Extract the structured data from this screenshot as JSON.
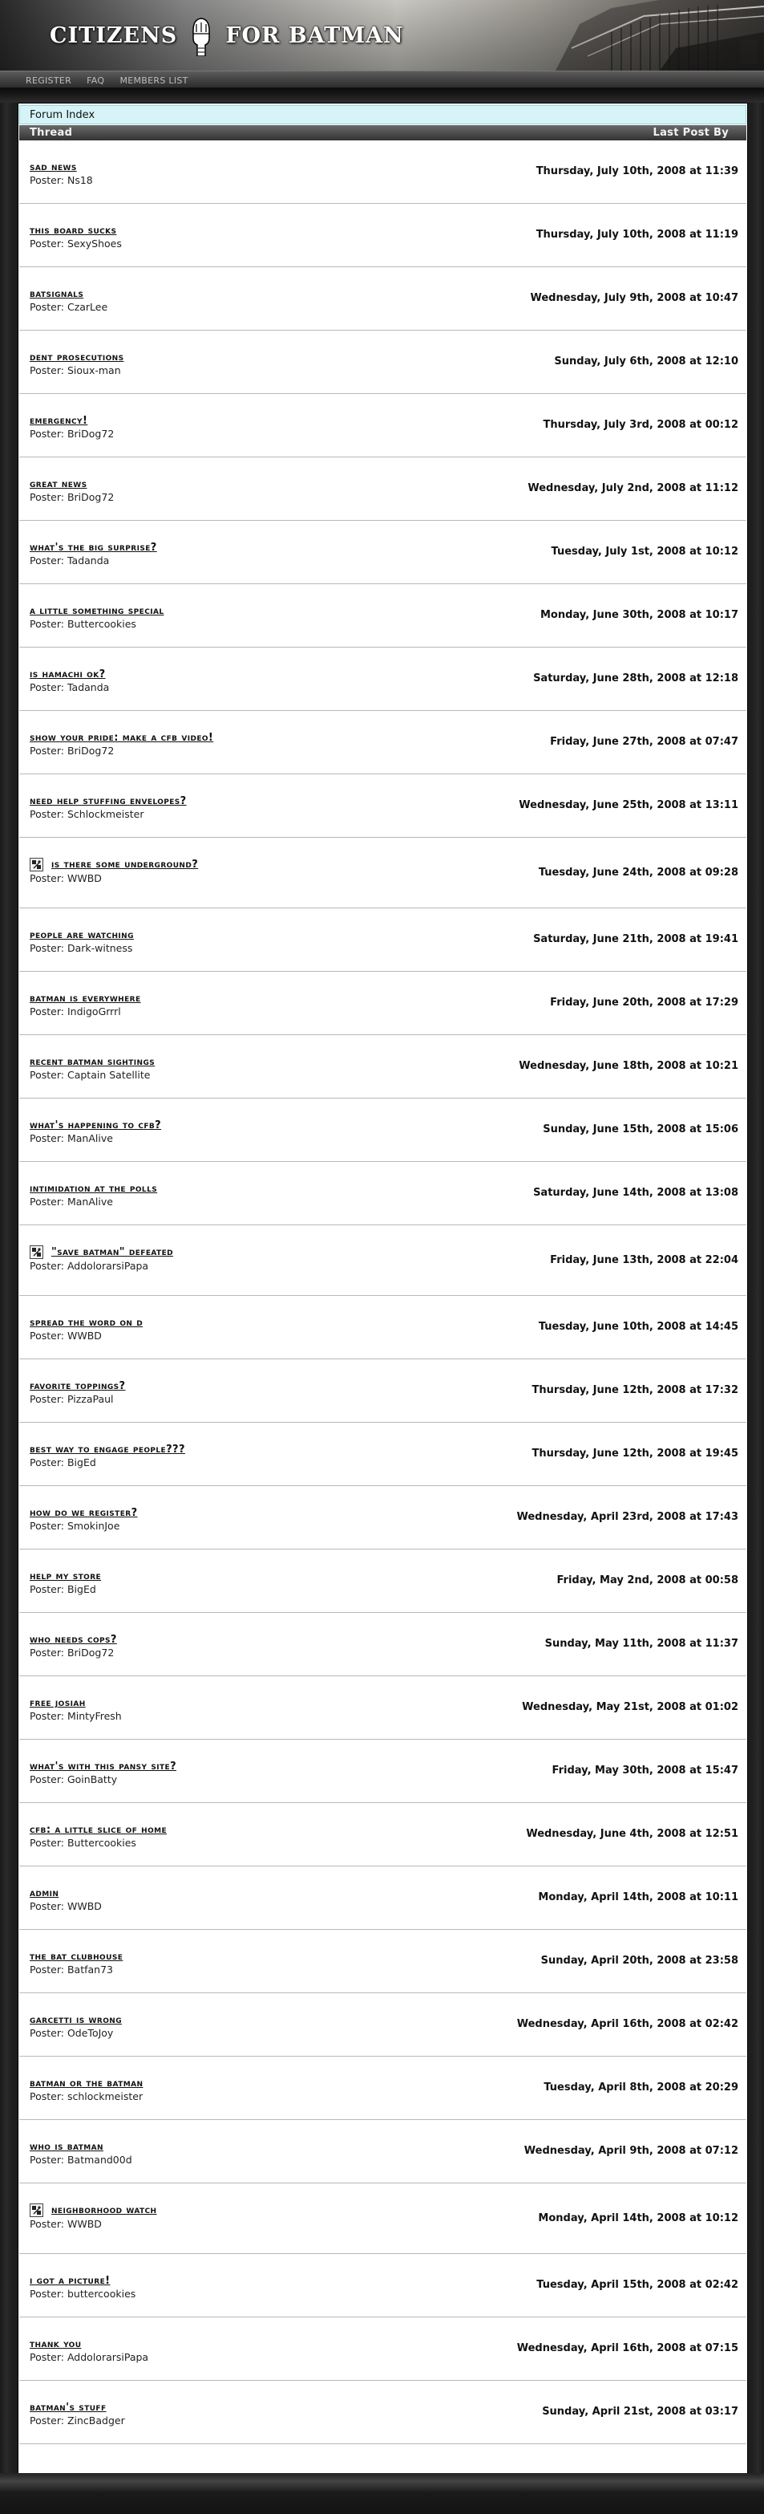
{
  "header": {
    "logo_left": "CITIZENS",
    "logo_right": "FOR BATMAN"
  },
  "nav": {
    "register": "REGISTER",
    "faq": "FAQ",
    "members": "MEMBERS LIST"
  },
  "forum": {
    "breadcrumb": "Forum Index",
    "col_thread": "Thread",
    "col_last_post": "Last Post By",
    "poster_prefix": "Poster:"
  },
  "threads": [
    {
      "title": "SAD NEWS",
      "poster": "Ns18",
      "date": "Thursday, July 10th, 2008 at 11:39",
      "icon": false
    },
    {
      "title": "THIS BOARD SUCKS",
      "poster": "SexyShoes",
      "date": "Thursday, July 10th, 2008 at 11:19",
      "icon": false
    },
    {
      "title": "BATSIGNALS",
      "poster": "CzarLee",
      "date": "Wednesday, July 9th, 2008 at 10:47",
      "icon": false
    },
    {
      "title": "DENT PROSECUTIONS",
      "poster": "Sioux-man",
      "date": "Sunday, July 6th, 2008 at 12:10",
      "icon": false
    },
    {
      "title": "EMERGENCY!",
      "poster": "BriDog72",
      "date": "Thursday, July 3rd, 2008 at 00:12",
      "icon": false
    },
    {
      "title": "GREAT NEWS",
      "poster": "BriDog72",
      "date": "Wednesday, July 2nd, 2008 at 11:12",
      "icon": false
    },
    {
      "title": "WHAT'S THE BIG SURPRISE?",
      "poster": "Tadanda",
      "date": "Tuesday, July 1st, 2008 at 10:12",
      "icon": false
    },
    {
      "title": "A LITTLE SOMETHING SPECIAL",
      "poster": "Buttercookies",
      "date": "Monday, June 30th, 2008 at 10:17",
      "icon": false
    },
    {
      "title": "IS HAMACHI OK?",
      "poster": "Tadanda",
      "date": "Saturday, June 28th, 2008 at 12:18",
      "icon": false
    },
    {
      "title": "SHOW YOUR PRIDE: MAKE A CFB VIDEO!",
      "poster": "BriDog72",
      "date": "Friday, June 27th, 2008 at 07:47",
      "icon": false
    },
    {
      "title": "NEED HELP STUFFING ENVELOPES?",
      "poster": "Schlockmeister",
      "date": "Wednesday, June 25th, 2008 at 13:11",
      "icon": false
    },
    {
      "title": "IS THERE SOME UNDERGROUND?",
      "poster": "WWBD",
      "date": "Tuesday, June 24th, 2008 at 09:28",
      "icon": true
    },
    {
      "title": "PEOPLE ARE WATCHING",
      "poster": "Dark-witness",
      "date": "Saturday, June 21th, 2008 at 19:41",
      "icon": false
    },
    {
      "title": "BATMAN IS EVERYWHERE",
      "poster": "IndigoGrrrl",
      "date": "Friday, June 20th, 2008 at 17:29",
      "icon": false
    },
    {
      "title": "RECENT BATMAN SIGHTINGS",
      "poster": "Captain Satellite",
      "date": "Wednesday, June 18th, 2008 at 10:21",
      "icon": false
    },
    {
      "title": "WHAT'S HAPPENING TO CFB?",
      "poster": "ManAlive",
      "date": "Sunday, June 15th, 2008 at 15:06",
      "icon": false
    },
    {
      "title": "INTIMIDATION AT THE POLLS",
      "poster": "ManAlive",
      "date": "Saturday, June 14th, 2008 at 13:08",
      "icon": false
    },
    {
      "title": "\"SAVE BATMAN\" DEFEATED",
      "poster": "AddolorarsiPapa",
      "date": "Friday, June 13th, 2008 at 22:04",
      "icon": true
    },
    {
      "title": "SPREAD THE WORD ON D",
      "poster": "WWBD",
      "date": "Tuesday, June 10th, 2008 at 14:45",
      "icon": false
    },
    {
      "title": "FAVORITE TOPPINGS?",
      "poster": "PizzaPaul",
      "date": "Thursday, June 12th, 2008 at 17:32",
      "icon": false
    },
    {
      "title": "BEST WAY TO ENGAGE PEOPLE???",
      "poster": "BigEd",
      "date": "Thursday, June 12th, 2008 at 19:45",
      "icon": false
    },
    {
      "title": "HOW DO WE REGISTER?",
      "poster": "SmokinJoe",
      "date": "Wednesday, April 23rd, 2008 at 17:43",
      "icon": false
    },
    {
      "title": "HELP MY STORE",
      "poster": "BigEd",
      "date": "Friday, May 2nd, 2008 at 00:58",
      "icon": false
    },
    {
      "title": "WHO NEEDS COPS?",
      "poster": "BriDog72",
      "date": "Sunday, May 11th, 2008 at 11:37",
      "icon": false
    },
    {
      "title": "FREE JOSIAH",
      "poster": "MintyFresh",
      "date": "Wednesday, May 21st, 2008 at 01:02",
      "icon": false
    },
    {
      "title": "WHAT'S WITH THIS PANSY SITE?",
      "poster": "GoinBatty",
      "date": "Friday, May 30th, 2008 at 15:47",
      "icon": false
    },
    {
      "title": "CFB: A LITTLE SLICE OF HOME",
      "poster": "Buttercookies",
      "date": "Wednesday, June 4th, 2008 at 12:51",
      "icon": false
    },
    {
      "title": "ADMIN",
      "poster": "WWBD",
      "date": "Monday, April 14th, 2008 at 10:11",
      "icon": false
    },
    {
      "title": "THE BAT CLUBHOUSE",
      "poster": "Batfan73",
      "date": "Sunday, April 20th, 2008 at 23:58",
      "icon": false
    },
    {
      "title": "GARCETTI IS WRONG",
      "poster": "OdeToJoy",
      "date": "Wednesday, April 16th, 2008 at 02:42",
      "icon": false
    },
    {
      "title": "BATMAN OR THE BATMAN",
      "poster": "schlockmeister",
      "date": "Tuesday, April 8th, 2008 at 20:29",
      "icon": false
    },
    {
      "title": "WHO IS BATMAN",
      "poster": "Batmand00d",
      "date": "Wednesday, April 9th, 2008 at 07:12",
      "icon": false
    },
    {
      "title": "NEIGHBORHOOD WATCH",
      "poster": "WWBD",
      "date": "Monday, April 14th, 2008 at 10:12",
      "icon": true
    },
    {
      "title": "I GOT A PICTURE!",
      "poster": "buttercookies",
      "date": "Tuesday, April 15th, 2008 at 02:42",
      "icon": false
    },
    {
      "title": "THANK YOU",
      "poster": "AddolorarsiPapa",
      "date": "Wednesday, April 16th, 2008 at 07:15",
      "icon": false
    },
    {
      "title": "BATMAN'S STUFF",
      "poster": "ZincBadger",
      "date": "Sunday, April 21st, 2008 at 03:17",
      "icon": false
    }
  ]
}
